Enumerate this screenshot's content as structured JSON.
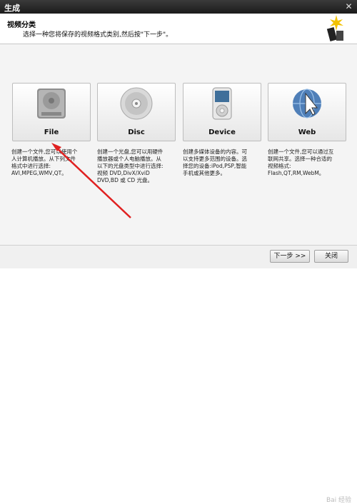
{
  "window": {
    "title": "生成",
    "close": "✕"
  },
  "header": {
    "title": "视频分类",
    "subtitle": "选择一种您将保存的视频格式类别,然后按\"下一步\"。"
  },
  "cards": [
    {
      "label": "File",
      "desc": [
        "创建一个文件,您可以使用个",
        "人计算机播放。从下列文件",
        "格式中进行选择:",
        "AVI,MPEG,WMV,QT。"
      ]
    },
    {
      "label": "Disc",
      "desc": [
        "创建一个光盘,您可以用硬件",
        "播放器或个人电脑播放。从",
        "以下的光盘类型中进行选择:",
        "视频 DVD,DivX/XviD",
        "DVD,BD 或 CD 光盘。"
      ]
    },
    {
      "label": "Device",
      "desc": [
        "创建多媒体设备的内容。可",
        "以支持更多范围的设备。选",
        "择您的设备:iPod,PSP,智能",
        "手机或其他更多。"
      ]
    },
    {
      "label": "Web",
      "desc": [
        "创建一个文件,您可以通过互",
        "联网共享。选择一种合适的",
        "视频格式:",
        "Flash,QT,RM,WebM。"
      ]
    }
  ],
  "footer": {
    "next": "下一步 >>",
    "close": "关闭"
  },
  "watermark": "Bai 经验"
}
